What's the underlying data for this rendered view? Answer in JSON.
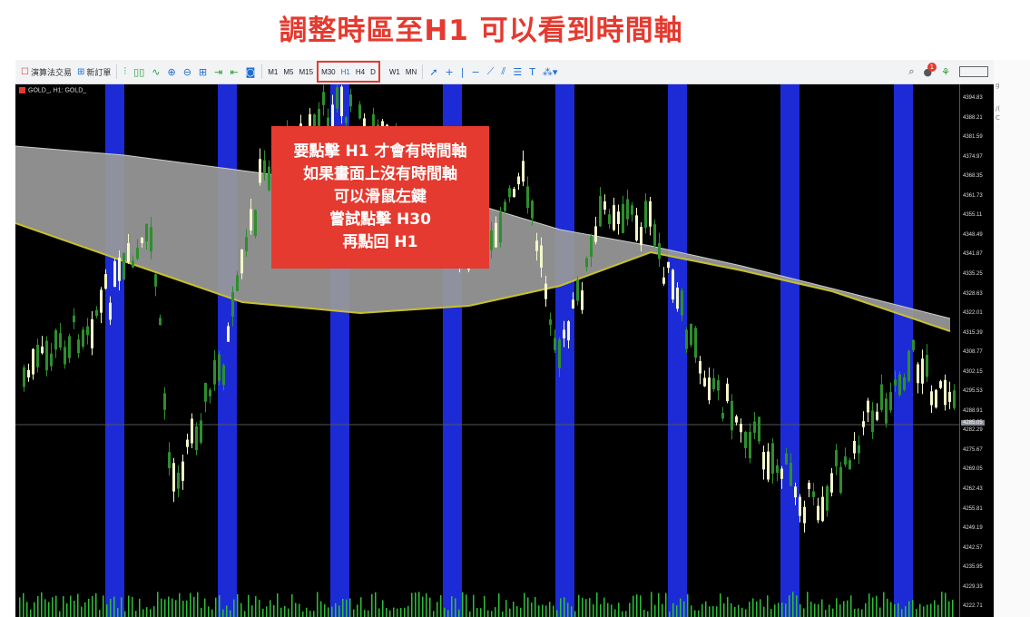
{
  "page_title": "調整時區至H1 可以看到時間軸",
  "toolbar": {
    "algo_label": "演算法交易",
    "new_order_label": "新訂單",
    "timeframes": [
      "M1",
      "M5",
      "M15",
      "M30",
      "H1",
      "H4",
      "D",
      "W1",
      "MN"
    ],
    "active_timeframe": "H1",
    "notification_count": "1"
  },
  "chart": {
    "symbol_label": "GOLD_, H1: GOLD_",
    "price_ticks": [
      "4394.83",
      "4388.21",
      "4381.59",
      "4374.97",
      "4368.35",
      "4361.73",
      "4355.11",
      "4348.49",
      "4341.87",
      "4335.25",
      "4328.63",
      "4322.01",
      "4315.39",
      "4308.77",
      "4302.15",
      "4295.53",
      "4288.91",
      "4282.29",
      "4275.67",
      "4269.05",
      "4262.43",
      "4255.81",
      "4249.19",
      "4242.57",
      "4235.95",
      "4229.33",
      "4222.71"
    ],
    "current_price": "4285.05",
    "colors": {
      "session_band": "#1d2bd6",
      "bull_candle": "#f3f7c9",
      "bear_candle": "#2d8f2d",
      "accent": "#e53a2f"
    }
  },
  "annotation": {
    "lines": [
      "要點擊 H1 才會有時間軸",
      "如果畫面上沒有時間軸",
      "可以滑鼠左鍵",
      "嘗試點擊 H30",
      "再點回 H1"
    ]
  },
  "side_strip": [
    "g",
    "/(",
    "C"
  ]
}
